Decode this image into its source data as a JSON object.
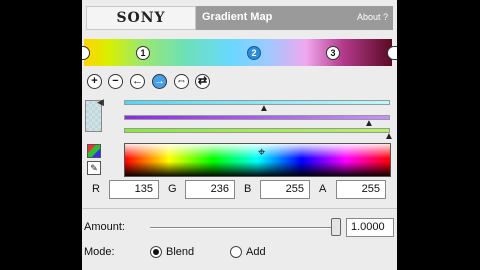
{
  "header": {
    "brand": "SONY",
    "title": "Gradient Map",
    "about": "About ?"
  },
  "gradient": {
    "stops": [
      "1",
      "2",
      "3"
    ],
    "selected_stop": "2"
  },
  "toolbar": {
    "icons": [
      "add-stop-icon",
      "remove-stop-icon",
      "previous-stop-icon",
      "next-stop-icon",
      "distribute-icon",
      "reverse-icon"
    ],
    "glyphs": [
      "+",
      "−",
      "←",
      "→",
      "⇔",
      "⇄"
    ]
  },
  "color": {
    "r_label": "R",
    "r_value": "135",
    "g_label": "G",
    "g_value": "236",
    "b_label": "B",
    "b_value": "255",
    "a_label": "A",
    "a_value": "255"
  },
  "amount": {
    "label": "Amount:",
    "value": "1.0000"
  },
  "mode": {
    "label": "Mode:",
    "options": [
      "Blend",
      "Add"
    ],
    "selected": "Blend"
  }
}
